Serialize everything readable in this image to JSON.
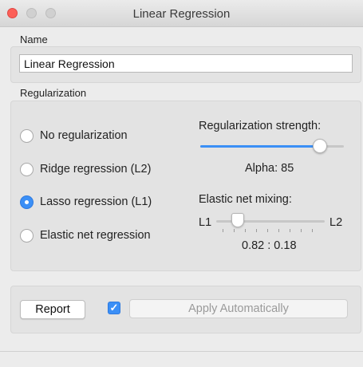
{
  "window": {
    "title": "Linear Regression"
  },
  "name_section": {
    "label": "Name",
    "value": "Linear Regression"
  },
  "regularization": {
    "label": "Regularization",
    "options": [
      {
        "label": "No regularization",
        "selected": false
      },
      {
        "label": "Ridge regression (L2)",
        "selected": false
      },
      {
        "label": "Lasso regression (L1)",
        "selected": true
      },
      {
        "label": "Elastic net regression",
        "selected": false
      }
    ],
    "strength": {
      "label": "Regularization strength:",
      "alpha_text": "Alpha: 85",
      "level_fraction": 0.89
    },
    "elastic": {
      "label": "Elastic net mixing:",
      "left_label": "L1",
      "right_label": "L2",
      "ratio_text": "0.82 : 0.18",
      "level_fraction": 0.18
    }
  },
  "footer": {
    "report_label": "Report",
    "auto_apply_checked": true,
    "apply_label": "Apply Automatically"
  },
  "colors": {
    "accent": "#3b8ff6",
    "close": "#fc5f57"
  },
  "icons": {
    "check": "✓"
  }
}
